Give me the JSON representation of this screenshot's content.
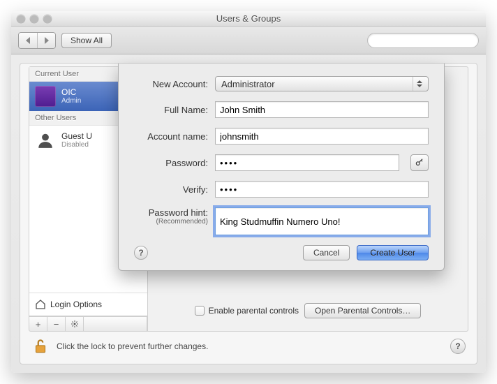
{
  "window": {
    "title": "Users & Groups"
  },
  "toolbar": {
    "show_all": "Show All",
    "search_placeholder": ""
  },
  "sidebar": {
    "headers": {
      "current": "Current User",
      "other": "Other Users"
    },
    "current": {
      "name": "OIC",
      "role": "Admin"
    },
    "other": [
      {
        "name": "Guest U",
        "role": "Disabled"
      }
    ],
    "login_options": "Login Options"
  },
  "rightpane": {
    "parental_checkbox": "Enable parental controls",
    "parental_button": "Open Parental Controls…"
  },
  "lockrow": {
    "text": "Click the lock to prevent further changes."
  },
  "sheet": {
    "labels": {
      "new_account": "New Account:",
      "full_name": "Full Name:",
      "account_name": "Account name:",
      "password": "Password:",
      "verify": "Verify:",
      "password_hint": "Password hint:",
      "recommended": "(Recommended)"
    },
    "values": {
      "account_type": "Administrator",
      "full_name": "John Smith",
      "account_name": "johnsmith",
      "password": "••••",
      "verify": "••••",
      "hint": "King Studmuffin Numero Uno!"
    },
    "buttons": {
      "cancel": "Cancel",
      "create": "Create User"
    }
  }
}
